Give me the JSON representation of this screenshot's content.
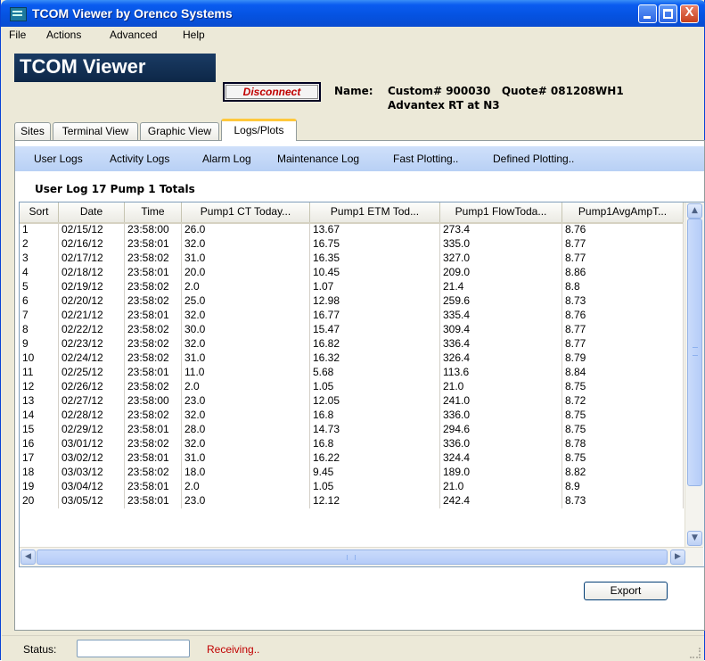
{
  "window": {
    "title": "TCOM Viewer by Orenco Systems",
    "close_glyph": "X"
  },
  "menu": [
    "File",
    "Actions",
    "Advanced",
    "Help"
  ],
  "header": {
    "logo_text": "TCOM Viewer",
    "disconnect_label": "Disconnect",
    "name_label": "Name:",
    "name_line1": "Custom# 900030   Quote# 081208WH1",
    "name_line2": "Advantex RT at N3"
  },
  "tabs": [
    "Sites",
    "Terminal View",
    "Graphic View",
    "Logs/Plots"
  ],
  "active_tab": "Logs/Plots",
  "subnav": [
    "User Logs",
    "Activity Logs",
    "Alarm Log",
    "Maintenance Log",
    "Fast Plotting..",
    "Defined Plotting.."
  ],
  "log_title": "User Log 17 Pump 1 Totals",
  "table": {
    "columns": [
      "Sort",
      "Date",
      "Time",
      "Pump1 CT Today...",
      "Pump1 ETM Tod...",
      "Pump1 FlowToda...",
      "Pump1AvgAmpT..."
    ],
    "rows": [
      [
        "1",
        "02/15/12",
        "23:58:00",
        "26.0",
        "13.67",
        "273.4",
        "8.76"
      ],
      [
        "2",
        "02/16/12",
        "23:58:01",
        "32.0",
        "16.75",
        "335.0",
        "8.77"
      ],
      [
        "3",
        "02/17/12",
        "23:58:02",
        "31.0",
        "16.35",
        "327.0",
        "8.77"
      ],
      [
        "4",
        "02/18/12",
        "23:58:01",
        "20.0",
        "10.45",
        "209.0",
        "8.86"
      ],
      [
        "5",
        "02/19/12",
        "23:58:02",
        "2.0",
        "1.07",
        "21.4",
        "8.8"
      ],
      [
        "6",
        "02/20/12",
        "23:58:02",
        "25.0",
        "12.98",
        "259.6",
        "8.73"
      ],
      [
        "7",
        "02/21/12",
        "23:58:01",
        "32.0",
        "16.77",
        "335.4",
        "8.76"
      ],
      [
        "8",
        "02/22/12",
        "23:58:02",
        "30.0",
        "15.47",
        "309.4",
        "8.77"
      ],
      [
        "9",
        "02/23/12",
        "23:58:02",
        "32.0",
        "16.82",
        "336.4",
        "8.77"
      ],
      [
        "10",
        "02/24/12",
        "23:58:02",
        "31.0",
        "16.32",
        "326.4",
        "8.79"
      ],
      [
        "11",
        "02/25/12",
        "23:58:01",
        "11.0",
        "5.68",
        "113.6",
        "8.84"
      ],
      [
        "12",
        "02/26/12",
        "23:58:02",
        "2.0",
        "1.05",
        "21.0",
        "8.75"
      ],
      [
        "13",
        "02/27/12",
        "23:58:00",
        "23.0",
        "12.05",
        "241.0",
        "8.72"
      ],
      [
        "14",
        "02/28/12",
        "23:58:02",
        "32.0",
        "16.8",
        "336.0",
        "8.75"
      ],
      [
        "15",
        "02/29/12",
        "23:58:01",
        "28.0",
        "14.73",
        "294.6",
        "8.75"
      ],
      [
        "16",
        "03/01/12",
        "23:58:02",
        "32.0",
        "16.8",
        "336.0",
        "8.78"
      ],
      [
        "17",
        "03/02/12",
        "23:58:01",
        "31.0",
        "16.22",
        "324.4",
        "8.75"
      ],
      [
        "18",
        "03/03/12",
        "23:58:02",
        "18.0",
        "9.45",
        "189.0",
        "8.82"
      ],
      [
        "19",
        "03/04/12",
        "23:58:01",
        "2.0",
        "1.05",
        "21.0",
        "8.9"
      ],
      [
        "20",
        "03/05/12",
        "23:58:01",
        "23.0",
        "12.12",
        "242.4",
        "8.73"
      ]
    ]
  },
  "export_label": "Export",
  "status": {
    "label": "Status:",
    "field_value": "",
    "text": "Receiving.."
  },
  "colors": {
    "title_bar": "#0552e0",
    "tab_highlight": "#ffc83c",
    "subnav_bg": "#b8d0f5",
    "status_text": "#c00000",
    "disconnect_text": "#c00000"
  }
}
